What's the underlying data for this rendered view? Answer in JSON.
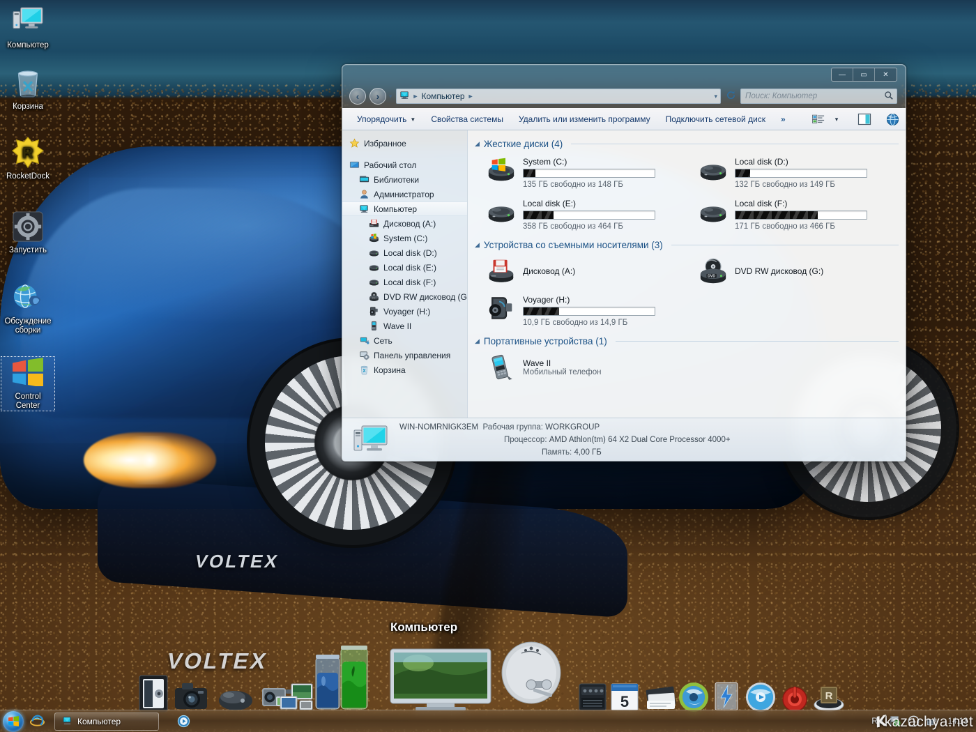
{
  "desktop": {
    "icons": [
      {
        "name": "computer",
        "label": "Компьютер",
        "icon": "computer-icon",
        "selected": false
      },
      {
        "name": "recycle-bin",
        "label": "Корзина",
        "icon": "recycle-bin-icon",
        "selected": false
      },
      {
        "name": "rocketdock",
        "label": "RocketDock",
        "icon": "rocketdock-icon",
        "selected": false
      },
      {
        "name": "launch",
        "label": "Запустить",
        "icon": "gear-icon",
        "selected": false
      },
      {
        "name": "build-discussion",
        "label": "Обсуждение\nсборки",
        "icon": "globe-mouse-icon",
        "selected": false
      },
      {
        "name": "control-center",
        "label": "Control\nCenter",
        "icon": "windows-flag-icon",
        "selected": true
      }
    ],
    "dock_tooltip": "Компьютер"
  },
  "window": {
    "controls": {
      "minimize": "—",
      "maximize": "▭",
      "close": "✕"
    },
    "nav": {
      "back": "‹",
      "forward": "›",
      "dropdown": "▾"
    },
    "address": {
      "root_icon": "computer-icon",
      "crumb": "Компьютер",
      "arrow": "►",
      "dropdown": "▾"
    },
    "refresh_icon": "refresh-icon",
    "search": {
      "placeholder": "Поиск: Компьютер",
      "value": "",
      "icon": "search-icon"
    },
    "toolbar": {
      "organize": "Упорядочить",
      "system_properties": "Свойства системы",
      "uninstall_change": "Удалить или изменить программу",
      "map_network_drive": "Подключить сетевой диск",
      "overflow": "»",
      "view_icon": "view-list-icon",
      "view_caret": "▾",
      "preview_pane_icon": "preview-pane-icon",
      "help_icon": "help-globe-icon"
    },
    "sidebar": {
      "items": [
        {
          "label": "Избранное",
          "icon": "star-icon",
          "level": 1,
          "selected": false,
          "gap_after": true
        },
        {
          "label": "Рабочий стол",
          "icon": "desktop-icon",
          "level": 1,
          "selected": false
        },
        {
          "label": "Библиотеки",
          "icon": "libraries-icon",
          "level": 2,
          "selected": false
        },
        {
          "label": "Администратор",
          "icon": "user-icon",
          "level": 2,
          "selected": false
        },
        {
          "label": "Компьютер",
          "icon": "computer-icon",
          "level": 2,
          "selected": true
        },
        {
          "label": "Дисковод (A:)",
          "icon": "floppy-icon",
          "level": 3,
          "selected": false
        },
        {
          "label": "System (C:)",
          "icon": "system-drive-icon",
          "level": 3,
          "selected": false
        },
        {
          "label": "Local disk (D:)",
          "icon": "drive-icon",
          "level": 3,
          "selected": false
        },
        {
          "label": "Local disk (E:)",
          "icon": "drive-icon",
          "level": 3,
          "selected": false
        },
        {
          "label": "Local disk (F:)",
          "icon": "drive-icon",
          "level": 3,
          "selected": false
        },
        {
          "label": "DVD RW дисковод (G:",
          "icon": "dvd-icon",
          "level": 3,
          "selected": false
        },
        {
          "label": "Voyager (H:)",
          "icon": "usb-drive-icon",
          "level": 3,
          "selected": false
        },
        {
          "label": "Wave II",
          "icon": "phone-icon",
          "level": 3,
          "selected": false
        },
        {
          "label": "Сеть",
          "icon": "network-icon",
          "level": 2,
          "selected": false
        },
        {
          "label": "Панель управления",
          "icon": "control-panel-icon",
          "level": 2,
          "selected": false
        },
        {
          "label": "Корзина",
          "icon": "recycle-bin-icon",
          "level": 2,
          "selected": false
        }
      ]
    },
    "groups": [
      {
        "name": "hard-disks",
        "title": "Жесткие диски (4)",
        "triangle": "◢",
        "items": [
          {
            "name": "System (C:)",
            "sub": "135 ГБ свободно из 148 ГБ",
            "fill_pct": 9,
            "icon": "system-drive-icon",
            "has_bar": true
          },
          {
            "name": "Local disk (D:)",
            "sub": "132 ГБ свободно из 149 ГБ",
            "fill_pct": 11,
            "icon": "drive-icon",
            "has_bar": true
          },
          {
            "name": "Local disk (E:)",
            "sub": "358 ГБ свободно из 464 ГБ",
            "fill_pct": 23,
            "icon": "drive-icon",
            "has_bar": true
          },
          {
            "name": "Local disk (F:)",
            "sub": "171 ГБ свободно из 466 ГБ",
            "fill_pct": 63,
            "icon": "drive-icon",
            "has_bar": true
          }
        ]
      },
      {
        "name": "removable-devices",
        "title": "Устройства со съемными носителями (3)",
        "triangle": "◢",
        "items": [
          {
            "name": "Дисковод (A:)",
            "sub": "",
            "fill_pct": 0,
            "icon": "floppy-icon",
            "has_bar": false
          },
          {
            "name": "DVD RW дисковод (G:)",
            "sub": "",
            "fill_pct": 0,
            "icon": "dvd-icon",
            "has_bar": false
          },
          {
            "name": "Voyager (H:)",
            "sub": "10,9 ГБ свободно из 14,9 ГБ",
            "fill_pct": 27,
            "icon": "usb-drive-icon",
            "has_bar": true
          }
        ]
      },
      {
        "name": "portable-devices",
        "title": "Портативные устройства (1)",
        "triangle": "◢",
        "items": [
          {
            "name": "Wave II",
            "sub": "Мобильный телефон",
            "fill_pct": 0,
            "icon": "phone-icon",
            "has_bar": false
          }
        ]
      }
    ],
    "status": {
      "computer_name": "WIN-NOMRNIGK3EM",
      "workgroup_label": "Рабочая группа:",
      "workgroup_value": "WORKGROUP",
      "processor_label": "Процессор:",
      "processor_value": "AMD Athlon(tm) 64 X2 Dual Core Processor 4000+",
      "memory_label": "Память:",
      "memory_value": "4,00 ГБ",
      "icon": "monitor-icon"
    }
  },
  "taskbar": {
    "start_icon": "windows-orb-icon",
    "quicklaunch": [
      {
        "name": "internet-explorer",
        "icon": "ie-icon"
      }
    ],
    "tasks": [
      {
        "label": "Компьютер",
        "icon": "computer-icon",
        "active": true
      }
    ],
    "extra": [
      {
        "name": "media-player",
        "icon": "media-player-icon"
      }
    ],
    "tray": {
      "language": "RU",
      "items": [
        {
          "name": "action-center",
          "icon": "flag-check-icon"
        },
        {
          "name": "clock-tray",
          "icon": "clock-icon"
        },
        {
          "name": "network",
          "icon": "network-plug-icon"
        }
      ],
      "clock": "14:13"
    }
  },
  "watermark": {
    "text": "kazachya.net"
  },
  "colors": {
    "accent": "#1c5286",
    "window_glass": "rgba(125,145,160,.42)",
    "content_bg": "#ffffff",
    "link_blue": "#14386b",
    "bar_fill": "#0c0c0c"
  }
}
